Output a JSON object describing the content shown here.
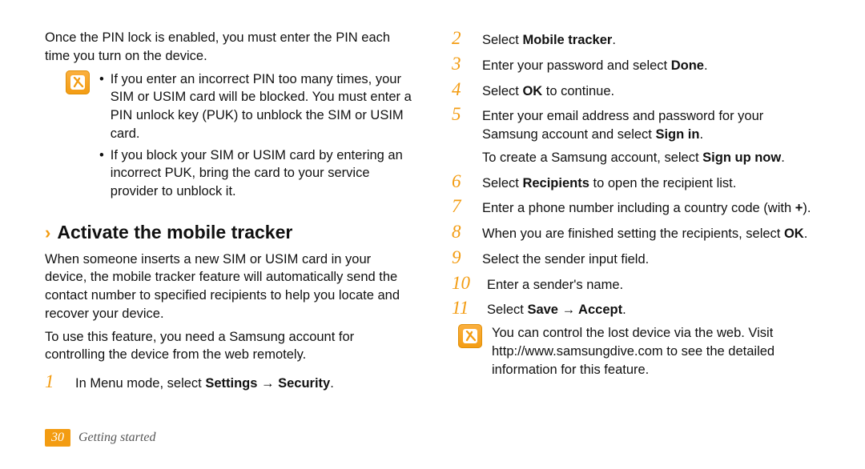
{
  "left": {
    "intro": "Once the PIN lock is enabled, you must enter the PIN each time you turn on the device.",
    "note_bullets": [
      "If you enter an incorrect PIN too many times, your SIM or USIM card will be blocked. You must enter a PIN unlock key (PUK) to unblock the SIM or USIM card.",
      "If you block your SIM or USIM card by entering an incorrect PUK, bring the card to your service provider to unblock it."
    ],
    "heading": "Activate the mobile tracker",
    "desc1": "When someone inserts a new SIM or USIM card in your device, the mobile tracker feature will automatically send the contact number to specified recipients to help you locate and recover your device.",
    "desc2": "To use this feature, you need a Samsung account for controlling the device from the web remotely.",
    "step1_pre": "In Menu mode, select ",
    "step1_bold": "Settings → Security",
    "step1_post": "."
  },
  "right": {
    "step2_pre": "Select ",
    "step2_bold": "Mobile tracker",
    "step2_post": ".",
    "step3_pre": "Enter your password and select ",
    "step3_bold": "Done",
    "step3_post": ".",
    "step4_pre": "Select ",
    "step4_bold": "OK",
    "step4_post": " to continue.",
    "step5_pre": "Enter your email address and password for your Samsung account and select ",
    "step5_bold": "Sign in",
    "step5_post": ".",
    "step5_sub_pre": "To create a Samsung account, select ",
    "step5_sub_bold": "Sign up now",
    "step5_sub_post": ".",
    "step6_pre": "Select ",
    "step6_bold": "Recipients",
    "step6_post": " to open the recipient list.",
    "step7_pre": "Enter a phone number including a country code (with ",
    "step7_bold": "+",
    "step7_post": ").",
    "step8_pre": "When you are finished setting the recipients, select ",
    "step8_bold": "OK",
    "step8_post": ".",
    "step9": "Select the sender input field.",
    "step10": "Enter a sender's name.",
    "step11_pre": "Select ",
    "step11_bold": "Save → Accept",
    "step11_post": ".",
    "note2": "You can control the lost device via the web. Visit http://www.samsungdive.com to see the detailed information for this feature."
  },
  "numbers": {
    "n1": "1",
    "n2": "2",
    "n3": "3",
    "n4": "4",
    "n5": "5",
    "n6": "6",
    "n7": "7",
    "n8": "8",
    "n9": "9",
    "n10": "10",
    "n11": "11"
  },
  "footer": {
    "page": "30",
    "section": "Getting started"
  }
}
